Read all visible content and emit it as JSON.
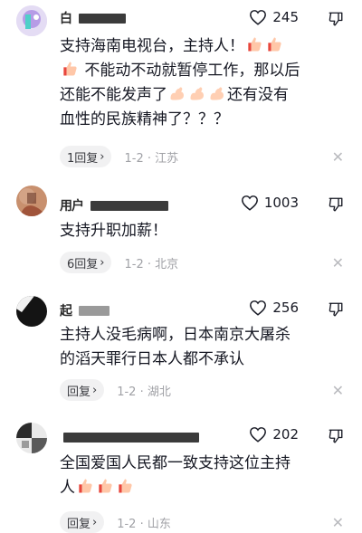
{
  "comments": [
    {
      "username": "白 ",
      "likes": "245",
      "text_lines": [
        "支持海南电视台，主持人！",
        " 不能动不动就暂停工作，那以后",
        "还能不能发声了",
        "还有没有",
        "血性的民族精神了？？？"
      ],
      "reply_label": "1回复",
      "time": "1-2",
      "location": "江苏"
    },
    {
      "username": "用户",
      "likes": "1003",
      "text_lines": [
        "支持升职加薪！"
      ],
      "reply_label": "6回复",
      "time": "1-2",
      "location": "北京"
    },
    {
      "username": "起",
      "likes": "256",
      "text_lines": [
        "主持人没毛病啊，日本南京大屠杀",
        "的滔天罪行日本人都不承认"
      ],
      "reply_label": "回复",
      "time": "1-2",
      "location": "湖北"
    },
    {
      "username": "",
      "likes": "202",
      "text_lines": [
        "全国爱国人民都一致支持这位主持",
        "人"
      ],
      "reply_label": "回复",
      "time": "1-2",
      "location": "山东"
    }
  ],
  "separator": "·",
  "icons": {
    "like": "heart-outline-icon",
    "dislike": "thumbs-down-outline-icon",
    "close": "close-icon",
    "emoji_thumbs": "thumbs-up-emoji-icon",
    "emoji_muscle": "flexed-biceps-emoji-icon"
  }
}
